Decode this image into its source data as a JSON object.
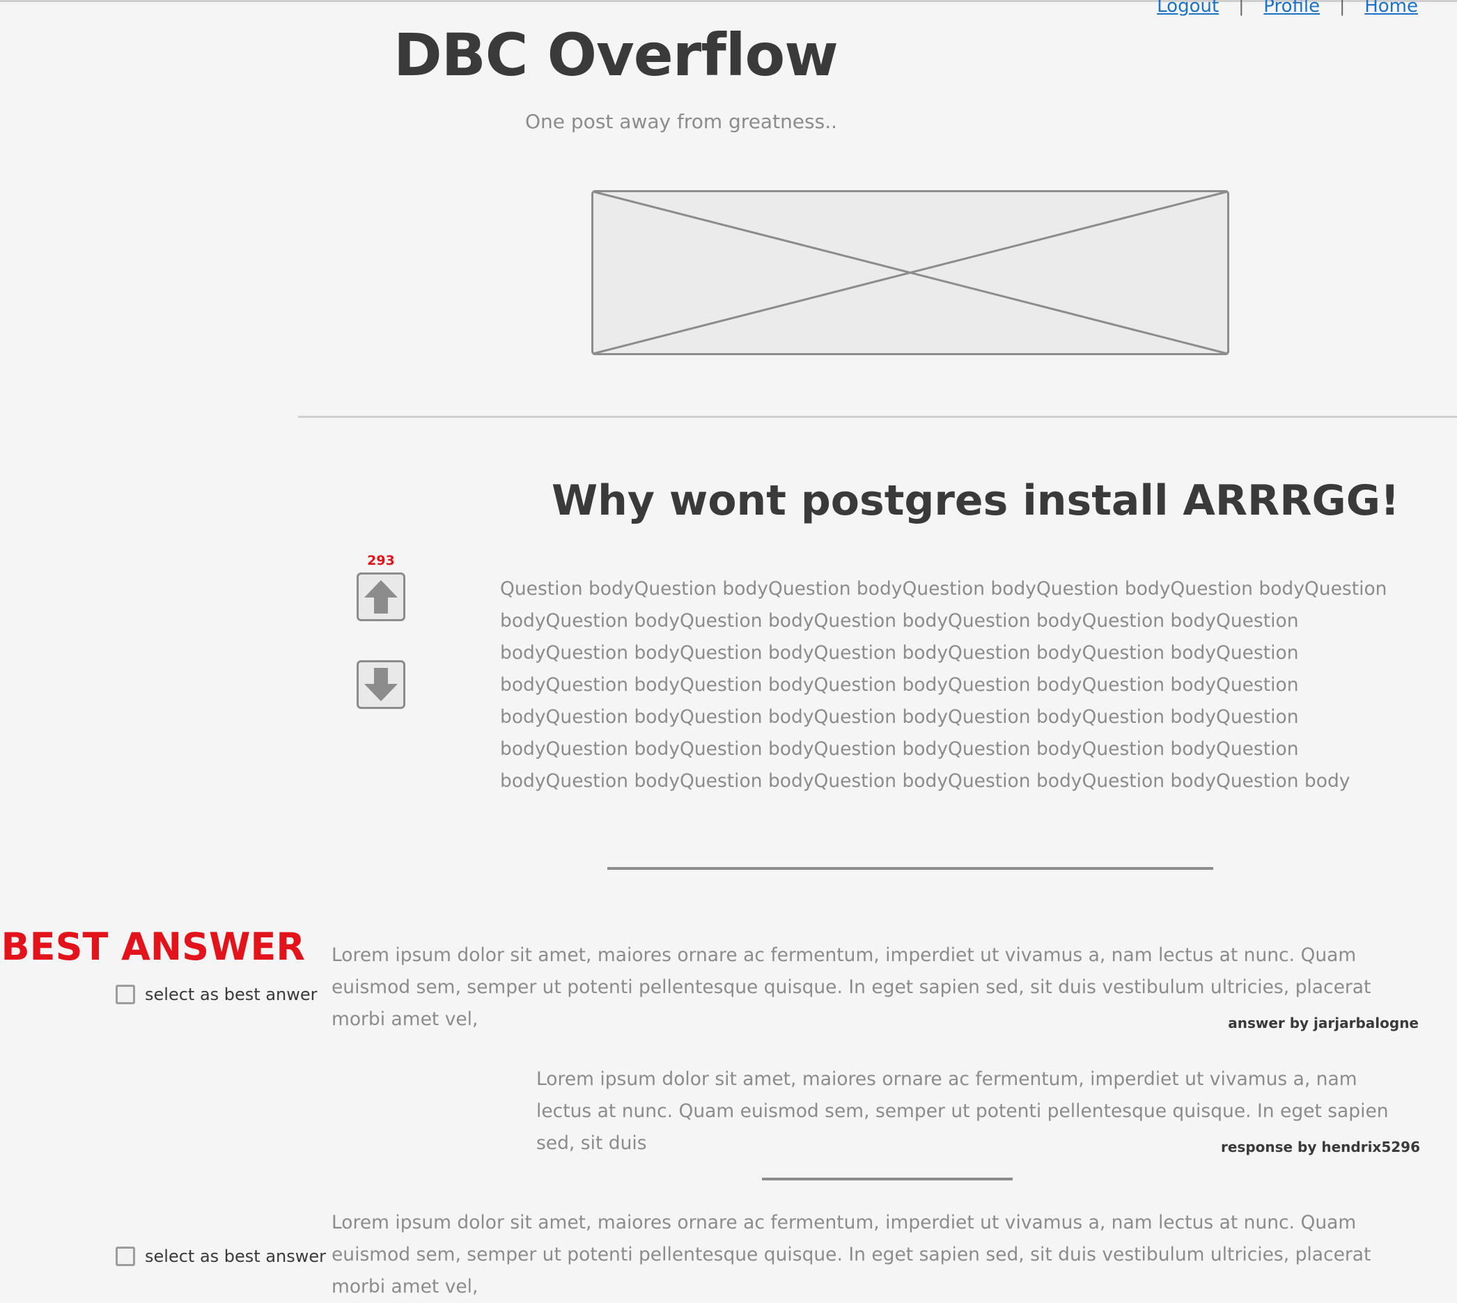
{
  "nav": {
    "logout": "Logout",
    "separator_1": "|",
    "profile": "Profile",
    "separator_2": "|",
    "home": "Home"
  },
  "header": {
    "title": "DBC Overflow",
    "tagline": "One post away from greatness.."
  },
  "question": {
    "title": "Why wont postgres install ARRRGG!",
    "votes": "293",
    "body": "Question bodyQuestion bodyQuestion bodyQuestion bodyQuestion bodyQuestion bodyQuestion bodyQuestion bodyQuestion bodyQuestion bodyQuestion bodyQuestion bodyQuestion bodyQuestion bodyQuestion bodyQuestion bodyQuestion bodyQuestion bodyQuestion bodyQuestion bodyQuestion bodyQuestion bodyQuestion bodyQuestion bodyQuestion bodyQuestion bodyQuestion bodyQuestion bodyQuestion bodyQuestion bodyQuestion bodyQuestion bodyQuestion bodyQuestion bodyQuestion bodyQuestion bodyQuestion bodyQuestion bodyQuestion bodyQuestion bodyQuestion bodyQuestion bodyQuestion body"
  },
  "answers": [
    {
      "best_label": "BEST ANSWER",
      "select_label": "select as best anwer",
      "body": "Lorem ipsum dolor sit amet, maiores ornare ac fermentum, imperdiet ut vivamus a, nam lectus at nunc. Quam euismod sem, semper ut potenti pellentesque quisque. In eget sapien sed, sit duis vestibulum ultricies, placerat morbi amet vel,",
      "byline": "answer  by jarjarbalogne",
      "response": {
        "body": "Lorem ipsum dolor sit amet, maiores ornare ac fermentum, imperdiet ut vivamus a, nam lectus at nunc. Quam euismod sem, semper ut potenti pellentesque quisque. In eget sapien sed, sit duis",
        "byline": "response by hendrix5296"
      }
    },
    {
      "select_label": "select as best answer",
      "body": "Lorem ipsum dolor sit amet, maiores ornare ac fermentum, imperdiet ut vivamus a, nam lectus at nunc. Quam euismod sem, semper ut potenti pellentesque quisque. In eget sapien sed, sit duis vestibulum ultricies, placerat morbi amet vel,"
    }
  ],
  "colors": {
    "background": "#f5f5f5",
    "link": "#1a73c9",
    "accent_red": "#e3131b",
    "heading": "#3a3a3a",
    "body_text": "#8c8c8c"
  },
  "icons": [
    "image-placeholder-icon",
    "arrow-up-icon",
    "arrow-down-icon",
    "checkbox-icon"
  ]
}
